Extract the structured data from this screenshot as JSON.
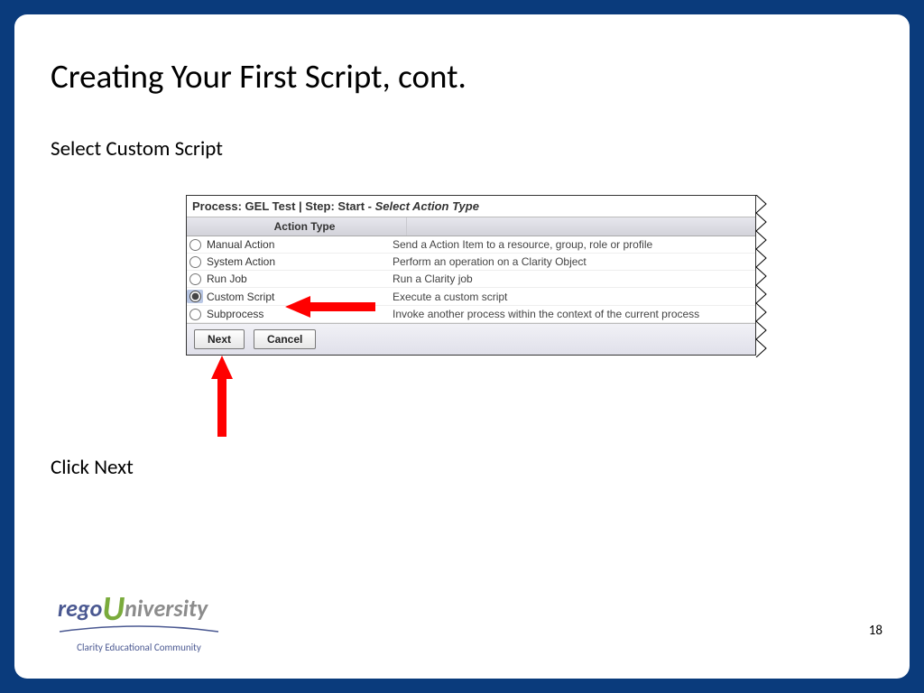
{
  "slide": {
    "title": "Creating Your First Script, cont.",
    "subtitle": "Select Custom Script",
    "click_next": "Click Next",
    "page_number": "18"
  },
  "dialog": {
    "breadcrumb_prefix": "Process: ",
    "process_name": "GEL Test",
    "separator": " | ",
    "step_prefix": "Step: ",
    "step_name": "Start",
    "dash": " - ",
    "action_heading": "Select Action Type",
    "column_header": "Action Type",
    "rows": [
      {
        "name": "Manual Action",
        "desc": "Send a Action Item to a resource, group, role or profile",
        "selected": false
      },
      {
        "name": "System Action",
        "desc": "Perform an operation on a Clarity Object",
        "selected": false
      },
      {
        "name": "Run Job",
        "desc": "Run a Clarity job",
        "selected": false
      },
      {
        "name": "Custom Script",
        "desc": "Execute a custom script",
        "selected": true
      },
      {
        "name": "Subprocess",
        "desc": "Invoke another process within the context of the current process",
        "selected": false
      }
    ],
    "buttons": {
      "next": "Next",
      "cancel": "Cancel"
    }
  },
  "logo": {
    "part1": "rego",
    "part2": "U",
    "part3": "niversity",
    "subtitle": "Clarity Educational Community"
  }
}
